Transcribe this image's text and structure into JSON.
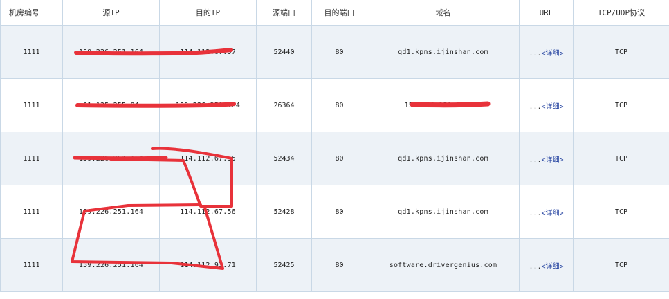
{
  "headers": [
    "机房编号",
    "源IP",
    "目的IP",
    "源端口",
    "目的端口",
    "域名",
    "URL",
    "TCP/UDP协议"
  ],
  "rows": [
    {
      "room": "1111",
      "src_ip": "159.226.251.164",
      "dst_ip": "114.112.67.57",
      "src_port": "52440",
      "dst_port": "80",
      "domain": "qd1.kpns.ijinshan.com",
      "url_prefix": "...",
      "url_label": "<详细>",
      "proto": "TCP"
    },
    {
      "room": "1111",
      "src_ip": "61.135.255.84",
      "dst_ip": "159.226.251.164",
      "src_port": "26364",
      "dst_port": "80",
      "domain": "159.226.251.164:80",
      "url_prefix": "...",
      "url_label": "<详细>",
      "proto": "TCP"
    },
    {
      "room": "1111",
      "src_ip": "159.226.251.164",
      "dst_ip": "114.112.67.55",
      "src_port": "52434",
      "dst_port": "80",
      "domain": "qd1.kpns.ijinshan.com",
      "url_prefix": "...",
      "url_label": "<详细>",
      "proto": "TCP"
    },
    {
      "room": "1111",
      "src_ip": "159.226.251.164",
      "dst_ip": "114.112.67.56",
      "src_port": "52428",
      "dst_port": "80",
      "domain": "qd1.kpns.ijinshan.com",
      "url_prefix": "...",
      "url_label": "<详细>",
      "proto": "TCP"
    },
    {
      "room": "1111",
      "src_ip": "159.226.251.164",
      "dst_ip": "114.112.93.71",
      "src_port": "52425",
      "dst_port": "80",
      "domain": "software.drivergenius.com",
      "url_prefix": "...",
      "url_label": "<详细>",
      "proto": "TCP"
    }
  ],
  "colors": {
    "header_border": "#c9d8e6",
    "row_alt_bg": "#edf2f7",
    "link": "#1a3a9c",
    "redaction": "#e8323a"
  }
}
